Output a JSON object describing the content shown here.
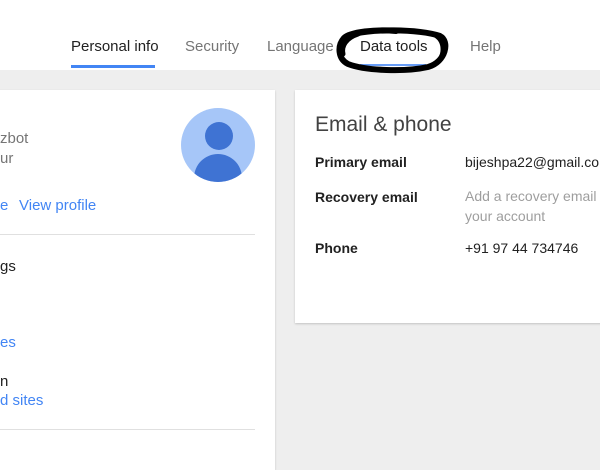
{
  "tabs": [
    {
      "label": "Personal info",
      "active": true
    },
    {
      "label": "Security",
      "active": false
    },
    {
      "label": "Language",
      "active": false
    },
    {
      "label": "Data tools",
      "active": false
    },
    {
      "label": "Help",
      "active": false
    }
  ],
  "colors": {
    "accent": "#4285f4",
    "marker": "#000000",
    "avatar_bg": "#a6c6f8",
    "avatar_fg": "#3f73d3"
  },
  "profile_card": {
    "name_fragment": "zbot",
    "subtitle_fragment": "ur",
    "link_fragment": "e",
    "view_profile": "View profile",
    "avatar_icon": "person-avatar-icon",
    "items": [
      {
        "text": "gs"
      },
      {
        "text": "es"
      },
      {
        "text": "n"
      },
      {
        "text": "d sites"
      }
    ]
  },
  "contact_card": {
    "title": "Email & phone",
    "primary_email_label": "Primary email",
    "primary_email_value": "bijeshpa22@gmail.co",
    "recovery_email_label": "Recovery email",
    "recovery_email_placeholder": "Add a recovery email to your account",
    "phone_label": "Phone",
    "phone_value": "+91 97 44 734746"
  }
}
